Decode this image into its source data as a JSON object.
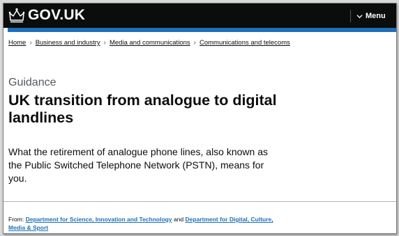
{
  "header": {
    "logo_text": "GOV.UK",
    "menu_label": "Menu"
  },
  "breadcrumbs": [
    {
      "label": "Home"
    },
    {
      "label": "Business and industry"
    },
    {
      "label": "Media and communications"
    },
    {
      "label": "Communications and telecoms"
    }
  ],
  "main": {
    "caption": "Guidance",
    "title": "UK transition from analogue to digital landlines",
    "lead": "What the retirement of analogue phone lines, also known as the Public Switched Telephone Network (PSTN), means for you."
  },
  "metadata": {
    "from_label": "From:",
    "org1": "Department for Science, Innovation and Technology",
    "conjunction": "and",
    "org2": "Department for Digital, Culture, Media & Sport"
  },
  "colors": {
    "header_bg": "#0b0c0c",
    "accent_blue": "#1d70b8",
    "link": "#1d70b8",
    "secondary_text": "#505a5f"
  },
  "icons": {
    "logo": "crown-icon",
    "menu": "chevron-down-icon",
    "breadcrumb_separator": "chevron-right-icon"
  }
}
